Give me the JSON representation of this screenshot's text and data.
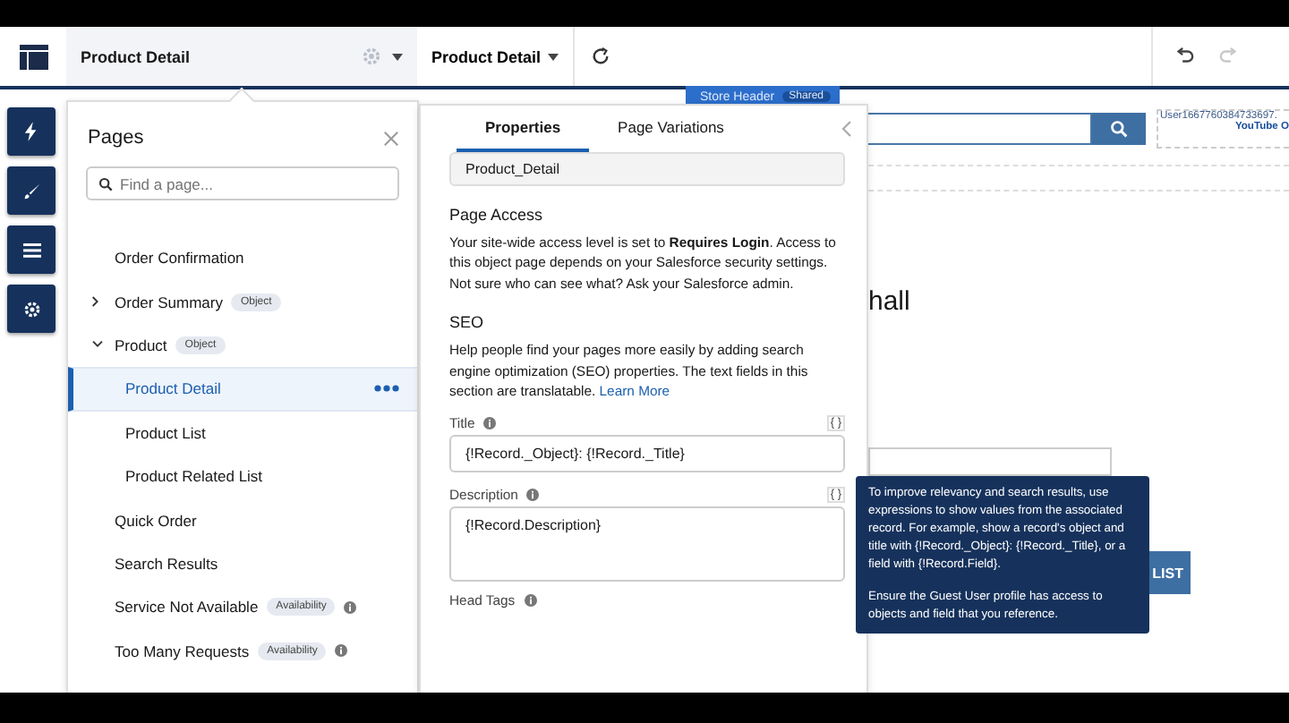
{
  "top_bar": {
    "page_title": "Product Detail",
    "page_menu": "Product Detail"
  },
  "canvas": {
    "region_label": "Store Header",
    "region_badge": "Shared",
    "user_name": "User1667760384733697.",
    "user_link": "YouTube O",
    "heading_fragment": "hall",
    "button_fragment": "LIST"
  },
  "pages_panel": {
    "title": "Pages",
    "search": {
      "placeholder": "Find a page..."
    },
    "items": [
      {
        "label": "Order Confirmation",
        "selected": false,
        "info": false
      },
      {
        "label": "Order Summary",
        "badge": "Object",
        "expanded": false,
        "selected": false,
        "info": false
      },
      {
        "label": "Product",
        "badge": "Object",
        "expanded": true,
        "selected": false,
        "info": false,
        "children": [
          {
            "label": "Product Detail",
            "selected": true
          },
          {
            "label": "Product List",
            "selected": false
          },
          {
            "label": "Product Related List",
            "selected": false
          }
        ]
      },
      {
        "label": "Quick Order",
        "selected": false,
        "info": false
      },
      {
        "label": "Search Results",
        "selected": false,
        "info": false
      },
      {
        "label": "Service Not Available",
        "badge": "Availability",
        "selected": false,
        "info": true
      },
      {
        "label": "Too Many Requests",
        "badge": "Availability",
        "selected": false,
        "info": true
      }
    ]
  },
  "properties_panel": {
    "tabs": [
      {
        "label": "Properties",
        "selected": true
      },
      {
        "label": "Page Variations",
        "selected": false
      }
    ],
    "api_name": "Product_Detail",
    "page_access": {
      "heading": "Page Access",
      "text": "Your site-wide access level is set to **Requires Login**. Access to this object page depends on your Salesforce security settings. Not sure who can see what? Ask your Salesforce admin."
    },
    "seo": {
      "heading": "SEO",
      "text": "Help people find your pages more easily by adding search engine optimization (SEO) properties. The text fields in this section are translatable.",
      "link": "Learn More"
    },
    "fields": [
      {
        "label": "Title",
        "value": "{!Record._Object}: {!Record._Title}",
        "expression": "{ }",
        "kind": "input"
      },
      {
        "label": "Description",
        "value": "{!Record.Description}",
        "expression": "{ }",
        "kind": "textarea"
      }
    ],
    "next_label": "Head Tags"
  },
  "tooltip": {
    "paragraphs": [
      "To improve relevancy and search results, use expressions to show values from the associated record. For example, show a record's object and title with {!Record._Object}: {!Record._Title}, or a field with {!Record.Field}.",
      "Ensure the Guest User profile has access to objects and field that you reference."
    ]
  }
}
